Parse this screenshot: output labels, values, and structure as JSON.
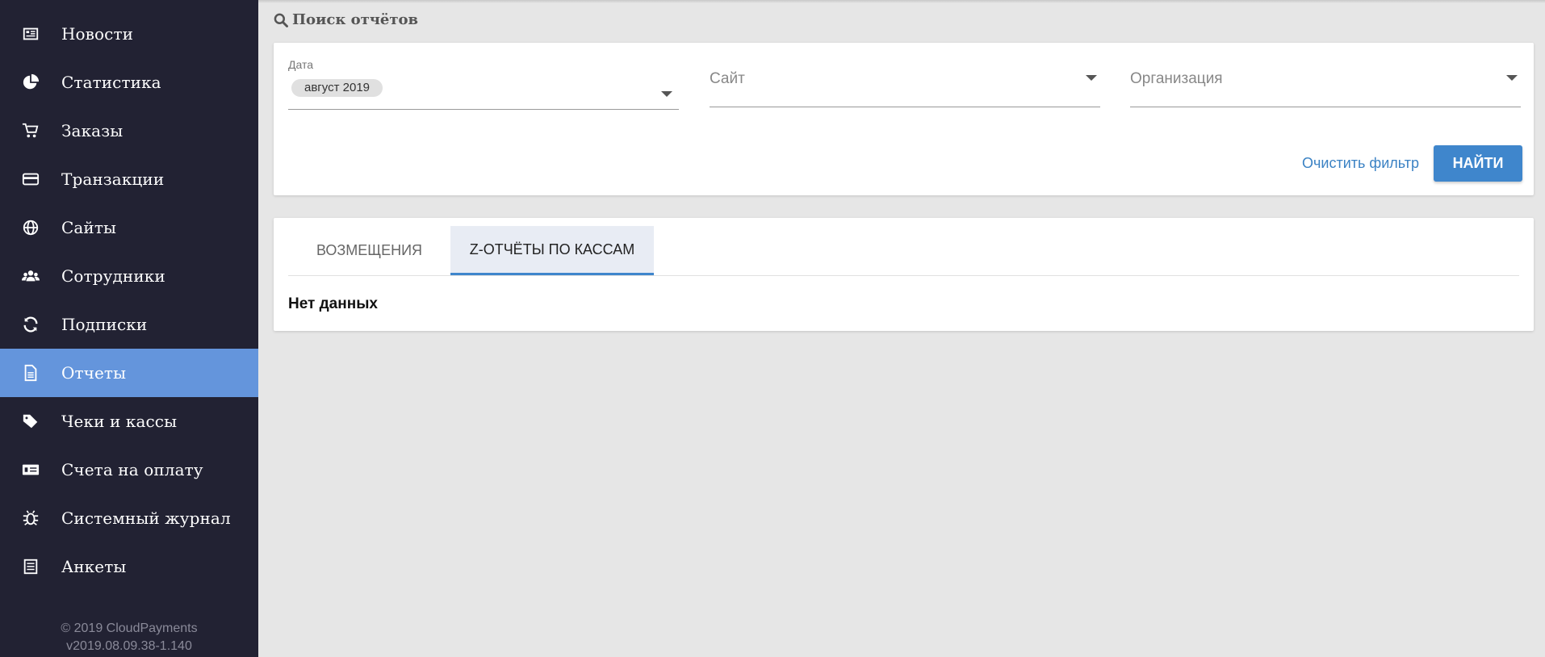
{
  "sidebar": {
    "items": [
      {
        "label": "Новости",
        "icon": "newspaper-icon"
      },
      {
        "label": "Статистика",
        "icon": "pie-chart-icon"
      },
      {
        "label": "Заказы",
        "icon": "cart-icon"
      },
      {
        "label": "Транзакции",
        "icon": "credit-card-icon"
      },
      {
        "label": "Сайты",
        "icon": "globe-icon"
      },
      {
        "label": "Сотрудники",
        "icon": "users-icon"
      },
      {
        "label": "Подписки",
        "icon": "refresh-icon"
      },
      {
        "label": "Отчеты",
        "icon": "document-icon"
      },
      {
        "label": "Чеки и кассы",
        "icon": "tags-icon"
      },
      {
        "label": "Счета на оплату",
        "icon": "invoice-icon"
      },
      {
        "label": "Системный журнал",
        "icon": "bug-icon"
      },
      {
        "label": "Анкеты",
        "icon": "form-icon"
      }
    ],
    "active_index": 7,
    "footer_copyright": "© 2019 CloudPayments",
    "footer_version": "v2019.08.09.38-1.140"
  },
  "search": {
    "title": "Поиск отчётов",
    "date_label": "Дата",
    "date_value": "август 2019",
    "site_placeholder": "Сайт",
    "org_placeholder": "Организация",
    "clear_label": "Очистить фильтр",
    "find_label": "НАЙТИ"
  },
  "results": {
    "tabs": [
      {
        "label": "ВОЗМЕЩЕНИЯ"
      },
      {
        "label": "Z-ОТЧЁТЫ ПО КАССАМ"
      }
    ],
    "active_tab": 1,
    "empty_text": "Нет данных"
  },
  "colors": {
    "sidebar_bg": "#222233",
    "active_item": "#6495dc",
    "accent": "#3f86cc"
  }
}
